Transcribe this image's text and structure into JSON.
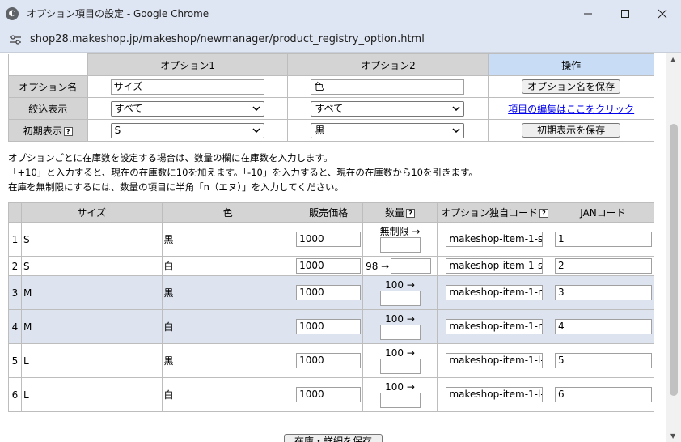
{
  "window": {
    "title": "オプション項目の設定 - Google Chrome",
    "url": "shop28.makeshop.jp/makeshop/newmanager/product_registry_option.html"
  },
  "options_table": {
    "headers": [
      "",
      "オプション1",
      "オプション2",
      "操作"
    ],
    "rows": {
      "name": {
        "label": "オプション名",
        "opt1": "サイズ",
        "opt2": "色",
        "action": "オプション名を保存"
      },
      "filter": {
        "label": "絞込表示",
        "opt1": "すべて",
        "opt2": "すべて",
        "action": "項目の編集はここをクリック"
      },
      "initial": {
        "label": "初期表示",
        "opt1": "S",
        "opt2": "黒",
        "action": "初期表示を保存"
      }
    }
  },
  "notes": [
    "オプションごとに在庫数を設定する場合は、数量の欄に在庫数を入力します。",
    "「+10」と入力すると、現在の在庫数に10を加えます。「-10」を入力すると、現在の在庫数から10を引きます。",
    "在庫を無制限にするには、数量の項目に半角「n（エヌ）」を入力してください。"
  ],
  "inventory_table": {
    "headers": [
      "",
      "サイズ",
      "色",
      "販売価格",
      "数量",
      "オプション独自コード",
      "JANコード"
    ],
    "rows": [
      {
        "no": "1",
        "size": "S",
        "color": "黒",
        "price": "1000",
        "qty_label": "無制限 →",
        "code": "makeshop-item-1-s",
        "jan": "1"
      },
      {
        "no": "2",
        "size": "S",
        "color": "白",
        "price": "1000",
        "qty_label": "98 →",
        "code": "makeshop-item-1-s",
        "jan": "2"
      },
      {
        "no": "3",
        "size": "M",
        "color": "黒",
        "price": "1000",
        "qty_label": "100 →",
        "code": "makeshop-item-1-n",
        "jan": "3"
      },
      {
        "no": "4",
        "size": "M",
        "color": "白",
        "price": "1000",
        "qty_label": "100 →",
        "code": "makeshop-item-1-n",
        "jan": "4"
      },
      {
        "no": "5",
        "size": "L",
        "color": "黒",
        "price": "1000",
        "qty_label": "100 →",
        "code": "makeshop-item-1-l-",
        "jan": "5"
      },
      {
        "no": "6",
        "size": "L",
        "color": "白",
        "price": "1000",
        "qty_label": "100 →",
        "code": "makeshop-item-1-l-",
        "jan": "6"
      }
    ]
  },
  "bottom_button": "在庫・詳細を保存",
  "icons": {
    "help": "?",
    "chevron": "⌄"
  }
}
